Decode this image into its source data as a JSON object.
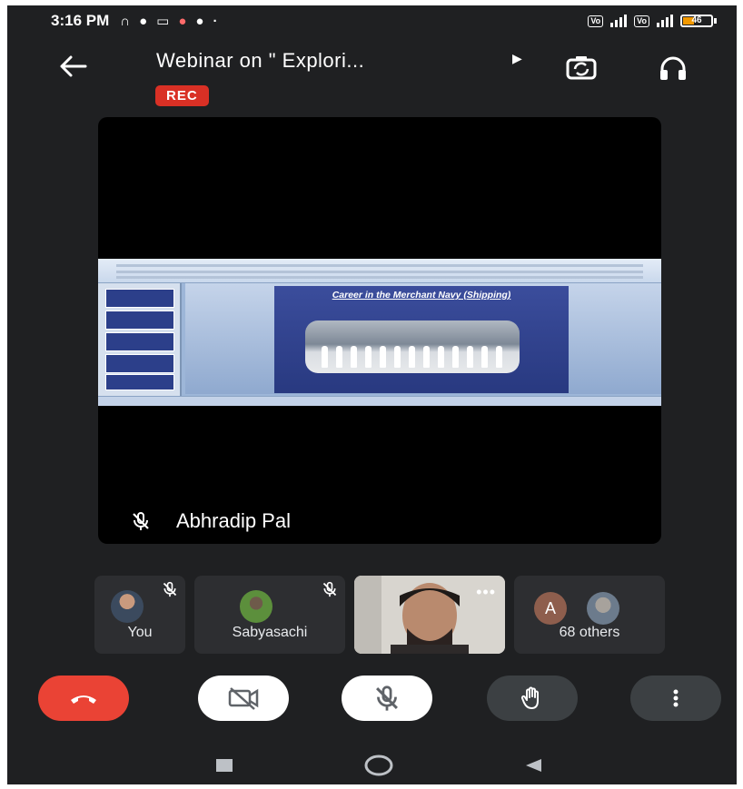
{
  "status_bar": {
    "time": "3:16 PM",
    "battery": "46"
  },
  "header": {
    "title": "Webinar on \" Explori...",
    "rec_badge": "REC"
  },
  "presentation": {
    "slide_title": "Career in the Merchant Navy (Shipping)"
  },
  "speaker": {
    "name": "Abhradip Pal"
  },
  "participants": [
    {
      "label": "You"
    },
    {
      "label": "Sabyasachi"
    },
    {
      "label": ""
    },
    {
      "label": "68 others",
      "avatar_letter": "A"
    }
  ],
  "colors": {
    "background": "#1f2022",
    "end_call": "#ea4335",
    "rec": "#d93025",
    "tile": "#2d2e31"
  },
  "icons": [
    "back-arrow-icon",
    "switch-camera-icon",
    "headphones-icon",
    "mic-off-icon",
    "more-dots-icon",
    "end-call-icon",
    "camera-off-icon",
    "raise-hand-icon",
    "more-vert-icon",
    "nav-square-icon",
    "nav-home-icon",
    "nav-back-icon"
  ]
}
